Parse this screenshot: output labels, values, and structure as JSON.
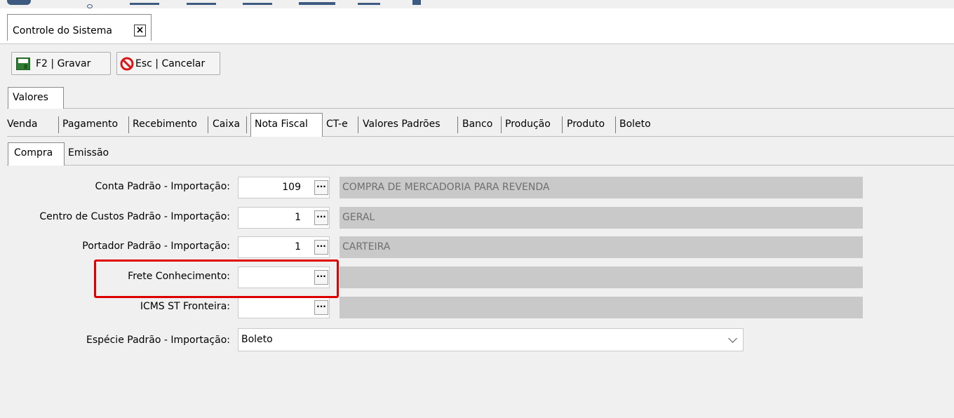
{
  "window": {
    "doc_tab_title": "Controle do Sistema",
    "doc_tab_close": "×"
  },
  "toolbar": {
    "save_label": "F2 | Gravar",
    "cancel_label": "Esc | Cancelar"
  },
  "tabs": {
    "main": [
      "Valores"
    ],
    "sections": [
      "Venda",
      "Pagamento",
      "Recebimento",
      "Caixa",
      "Nota Fiscal",
      "CT-e",
      "Valores Padrões",
      "Banco",
      "Produção",
      "Produto",
      "Boleto"
    ],
    "active_section": "Nota Fiscal",
    "sub": [
      "Compra",
      "Emissão"
    ],
    "active_sub": "Compra"
  },
  "form": {
    "conta_label": "Conta Padrão - Importação:",
    "conta_value": "109",
    "conta_desc": "COMPRA DE MERCADORIA PARA REVENDA",
    "centro_label": "Centro de Custos Padrão - Importação:",
    "centro_value": "1",
    "centro_desc": "GERAL",
    "portador_label": "Portador Padrão - Importação:",
    "portador_value": "1",
    "portador_desc": "CARTEIRA",
    "frete_label": "Frete Conhecimento:",
    "frete_value": "",
    "frete_desc": "",
    "icms_label": "ICMS ST Fronteira:",
    "icms_value": "",
    "icms_desc": "",
    "especie_label": "Espécie Padrão - Importação:",
    "especie_value": "Boleto",
    "ellipsis": "···"
  },
  "colors": {
    "highlight": "#e10000",
    "readonly_bg": "#c9c9c9",
    "save_icon": "#2e7d32",
    "cancel_icon": "#d81818"
  },
  "icons": [
    "save-icon",
    "cancel-icon",
    "close-icon",
    "chevron-down-icon",
    "ellipsis-button"
  ]
}
